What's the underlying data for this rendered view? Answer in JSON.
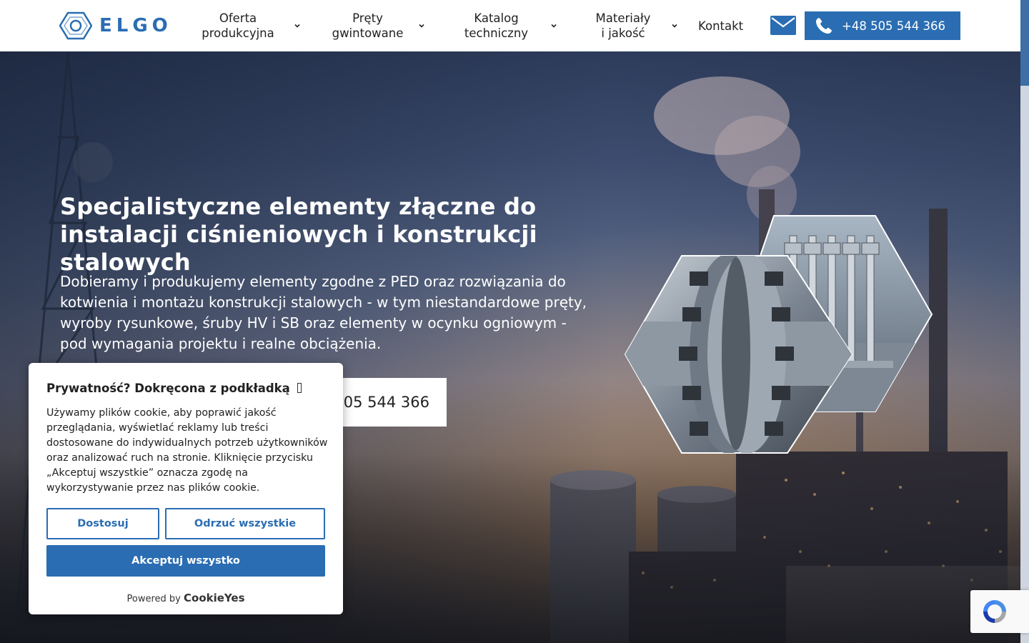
{
  "brand": {
    "name": "ELGO",
    "accent": "#2a6db3"
  },
  "nav": [
    {
      "line1": "Oferta",
      "line2": "produkcyjna",
      "dropdown": true
    },
    {
      "line1": "Pręty",
      "line2": "gwintowane",
      "dropdown": true
    },
    {
      "line1": "Katalog",
      "line2": "techniczny",
      "dropdown": true
    },
    {
      "line1": "Materiały",
      "line2": "i jakość",
      "dropdown": true
    },
    {
      "line1": "Kontakt",
      "line2": "",
      "dropdown": false
    }
  ],
  "header": {
    "mail_icon": "envelope-icon",
    "phone_icon": "phone-icon",
    "phone": "+48 505 544 366"
  },
  "hero": {
    "title": "Specjalistyczne elementy złączne do instalacji ciśnieniowych i konstrukcji stalowych",
    "description": "Dobieramy i produkujemy elementy zgodne z PED oraz rozwiązania do kotwienia i montażu konstrukcji stalowych - w tym niestandardowe pręty, wyroby rysunkowe, śruby HV i SB oraz elementy w ocynku ogniowym - pod wymagania projektu i realne obciążenia.",
    "cta": "05 544 366"
  },
  "cookie": {
    "title": "Prywatność? Dokręcona z podkładką",
    "text": "Używamy plików cookie, aby poprawić jakość przeglądania, wyświetlać reklamy lub treści dostosowane do indywidualnych potrzeb użytkowników oraz analizować ruch na stronie. Kliknięcie przycisku „Akceptuj wszystkie” oznacza zgodę na wykorzystywanie przez nas plików cookie.",
    "customize": "Dostosuj",
    "reject": "Odrzuć wszystkie",
    "accept": "Akceptuj wszystko",
    "powered_by": "Powered by",
    "powered_brand": "CookieYes"
  }
}
